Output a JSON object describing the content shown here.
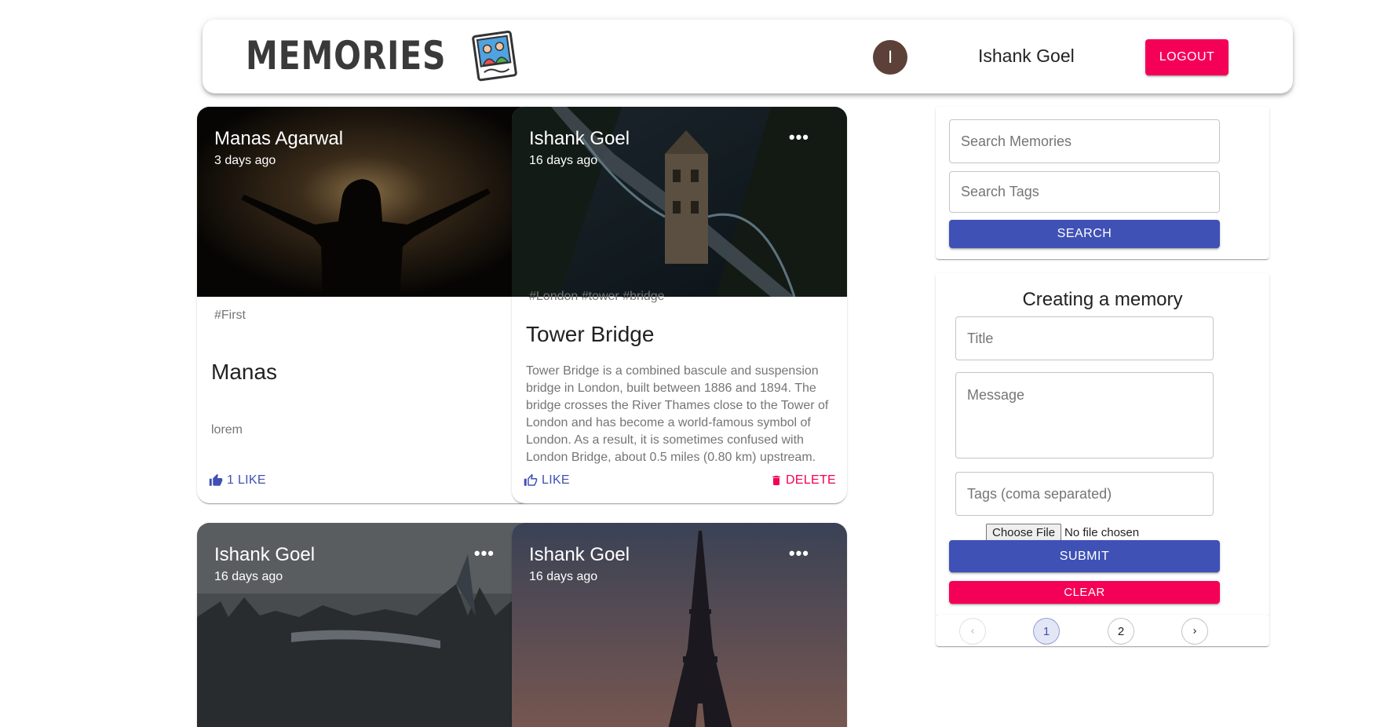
{
  "header": {
    "brand": "MEMORIES",
    "logo_icon": "photo-memories-icon",
    "avatar_initial": "I",
    "username": "Ishank Goel",
    "logout_label": "LOGOUT"
  },
  "posts": [
    {
      "author": "Manas Agarwal",
      "time": "3 days ago",
      "tags": "#First",
      "title": "Manas",
      "message": "lorem",
      "like_label": "1 LIKE",
      "has_more_menu": false,
      "has_delete": false
    },
    {
      "author": "Ishank Goel",
      "time": "16 days ago",
      "more": "•••",
      "tags": "#London #tower #bridge",
      "title": "Tower Bridge",
      "message": "Tower Bridge is a combined bascule and suspension bridge in London, built between 1886 and 1894. The bridge crosses the River Thames close to the Tower of London and has become a world-famous symbol of London. As a result, it is sometimes confused with London Bridge, about 0.5 miles (0.80 km) upstream.",
      "like_label": "LIKE",
      "delete_label": "DELETE",
      "has_more_menu": true,
      "has_delete": true
    },
    {
      "author": "Ishank Goel",
      "time": "16 days ago",
      "more": "•••",
      "has_more_menu": true
    },
    {
      "author": "Ishank Goel",
      "time": "16 days ago",
      "more": "•••",
      "has_more_menu": true
    }
  ],
  "search": {
    "memories_placeholder": "Search Memories",
    "tags_placeholder": "Search Tags",
    "button_label": "SEARCH"
  },
  "form": {
    "heading": "Creating a memory",
    "title_placeholder": "Title",
    "message_placeholder": "Message",
    "tags_placeholder": "Tags (coma separated)",
    "file_button": "Choose File",
    "file_status": "No file chosen",
    "submit_label": "SUBMIT",
    "clear_label": "CLEAR"
  },
  "pagination": {
    "prev_icon": "chevron-left-icon",
    "pages": [
      "1",
      "2"
    ],
    "current_page": "1",
    "next_icon": "chevron-right-icon"
  },
  "colors": {
    "primary": "#3f51b5",
    "secondary": "#f50057",
    "avatar": "#5d4037"
  }
}
